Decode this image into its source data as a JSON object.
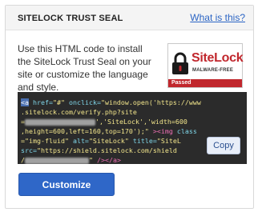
{
  "header": {
    "title": "SITELOCK TRUST SEAL",
    "help_link": "What is this?"
  },
  "description": "Use this HTML code to install the SiteLock Trust Seal on your site or customize the language and style.",
  "seal": {
    "brand": "SiteLock",
    "tagline": "MALWARE-FREE",
    "status": "Passed",
    "colors": {
      "brand_red": "#c1272d"
    }
  },
  "code": {
    "line1_tag": "<a",
    "line1_attr": " href=",
    "line1_href": "\"#\"",
    "line1_onclick_attr": " onclick=",
    "line1_onclick": "\"window.open('https://www",
    "line2": ".sitelock.com/verify.php?site",
    "line3_start": "=",
    "line3_end": "','SiteLock','width=600",
    "line4": ",height=600,left=160,top=170');\"",
    "line4_tag": " ><img",
    "line4_class": " class",
    "line5_val": "=\"img-fluid\"",
    "line5_alt_attr": " alt=",
    "line5_alt": "\"SiteLock\"",
    "line5_title_attr": " title=",
    "line5_title": "\"SiteL",
    "line6_src_attr": "src=",
    "line6_src": "\"https://shield.sitelock.com/shield",
    "line7_start": "/",
    "line7_end": "\"",
    "line7_close": " /></a>"
  },
  "copy_label": "Copy",
  "customize_label": "Customize",
  "colors": {
    "accent": "#2f67c8",
    "link": "#2a64c4",
    "code_bg": "#2b2b2b"
  }
}
